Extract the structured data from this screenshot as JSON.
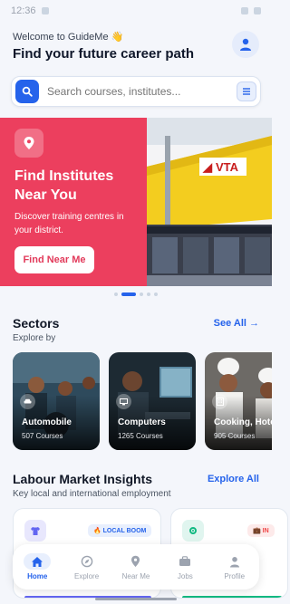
{
  "status_bar": {
    "time": "12:36"
  },
  "header": {
    "welcome": "Welcome to GuideMe 👋",
    "title": "Find your future career path"
  },
  "search": {
    "placeholder": "Search courses, institutes..."
  },
  "banner": {
    "title_line1": "Find Institutes",
    "title_line2": "Near You",
    "subtitle_line1": "Discover training centres in",
    "subtitle_line2": "your district.",
    "button": "Find Near Me",
    "photo_sign": "VTA",
    "color": "#ec3f5e",
    "page_count": 5,
    "active_page": 1
  },
  "sectors": {
    "title": "Sectors",
    "subtitle": "Explore by",
    "link": "See All →",
    "items": [
      {
        "name": "Automobile",
        "count": "507 Courses",
        "icon": "car-icon"
      },
      {
        "name": "Computers",
        "count": "1265 Courses",
        "icon": "computer-icon"
      },
      {
        "name": "Cooking, Hote",
        "count": "905 Courses",
        "icon": "building-icon"
      }
    ]
  },
  "insights": {
    "title": "Labour Market Insights",
    "subtitle": "Key local and international employment",
    "link": "Explore All",
    "cards": [
      {
        "badge": "🔥 LOCAL BOOM",
        "badge_color": "#2563eb",
        "icon": "shirt-icon"
      },
      {
        "badge": "💼 IN",
        "badge_color": "#ef4444",
        "icon": "gears-icon"
      }
    ]
  },
  "nav": {
    "items": [
      {
        "label": "Home",
        "icon": "home-icon",
        "active": true
      },
      {
        "label": "Explore",
        "icon": "compass-icon",
        "active": false
      },
      {
        "label": "Near Me",
        "icon": "location-pin-icon",
        "active": false
      },
      {
        "label": "Jobs",
        "icon": "briefcase-icon",
        "active": false
      },
      {
        "label": "Profile",
        "icon": "person-icon",
        "active": false
      }
    ]
  },
  "colors": {
    "accent": "#2563eb",
    "banner": "#ec3f5e"
  }
}
